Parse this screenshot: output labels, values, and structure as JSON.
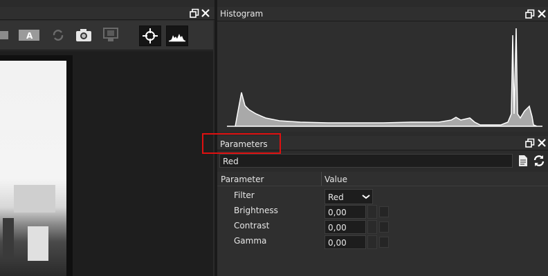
{
  "histogram_panel": {
    "title": "Histogram"
  },
  "parameters_panel": {
    "title": "Parameters",
    "preset": "Red",
    "table_headers": {
      "parameter": "Parameter",
      "value": "Value"
    },
    "rows": [
      {
        "label": "Filter",
        "value": "Red"
      },
      {
        "label": "Brightness",
        "value": "0,00"
      },
      {
        "label": "Contrast",
        "value": "0,00"
      },
      {
        "label": "Gamma",
        "value": "0,00"
      }
    ]
  },
  "toolbar": {
    "icons": [
      "square-icon",
      "text-overlay-icon",
      "rotate-icon",
      "camera-icon",
      "monitor-icon",
      "crosshair-icon",
      "histogram-icon"
    ]
  },
  "colors": {
    "highlight_border": "#e01010",
    "histogram_fill": "#a9a9a9",
    "histogram_line": "#ffffff"
  }
}
